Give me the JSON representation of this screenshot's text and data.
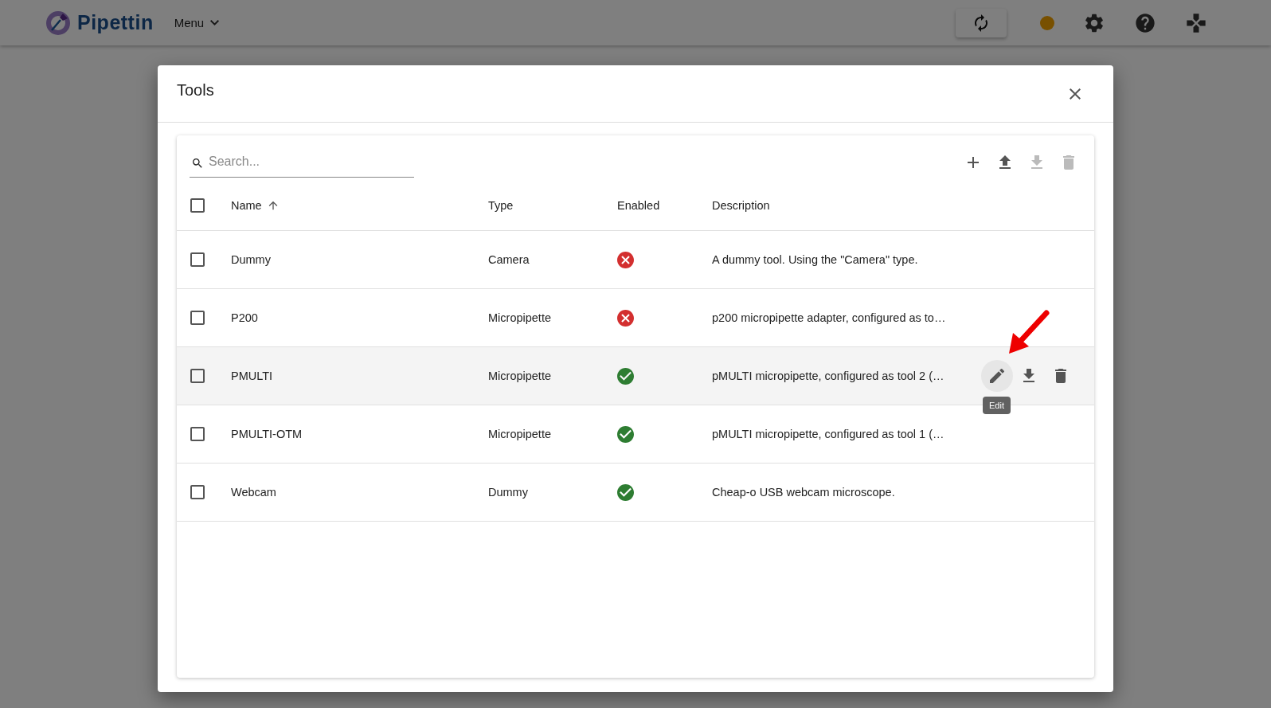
{
  "app_bar": {
    "brand": "Pipettin",
    "menu": "Menu"
  },
  "dialog": {
    "title": "Tools",
    "search": {
      "placeholder": "Search..."
    },
    "toolbar": [
      {
        "kind": "add",
        "disabled": false
      },
      {
        "kind": "upload",
        "disabled": false
      },
      {
        "kind": "download",
        "disabled": true
      },
      {
        "kind": "delete",
        "disabled": true
      }
    ],
    "select_all_checked": false,
    "columns": [
      {
        "label": "Name",
        "sorted": true
      },
      {
        "label": "Type",
        "sorted": false
      },
      {
        "label": "Enabled",
        "sorted": false
      },
      {
        "label": "Description",
        "sorted": false
      }
    ],
    "rows": [
      {
        "name": "Dummy",
        "type": "Camera",
        "enabled": false,
        "description": "A dummy tool. Using the \"Camera\" type.",
        "checked": false,
        "hovered": false
      },
      {
        "name": "P200",
        "type": "Micropipette",
        "enabled": false,
        "description": "p200 micropipette adapter, configured as to…",
        "checked": false,
        "hovered": false
      },
      {
        "name": "PMULTI",
        "type": "Micropipette",
        "enabled": true,
        "description": "pMULTI micropipette, configured as tool 2 (…",
        "checked": false,
        "hovered": true
      },
      {
        "name": "PMULTI-OTM",
        "type": "Micropipette",
        "enabled": true,
        "description": "pMULTI micropipette, configured as tool 1 (…",
        "checked": false,
        "hovered": false
      },
      {
        "name": "Webcam",
        "type": "Dummy",
        "enabled": true,
        "description": "Cheap-o USB webcam microscope.",
        "checked": false,
        "hovered": false
      }
    ],
    "row_actions": [
      {
        "kind": "edit",
        "focused": true,
        "tooltip": "Edit"
      },
      {
        "kind": "download",
        "focused": false
      },
      {
        "kind": "delete",
        "focused": false
      }
    ]
  }
}
